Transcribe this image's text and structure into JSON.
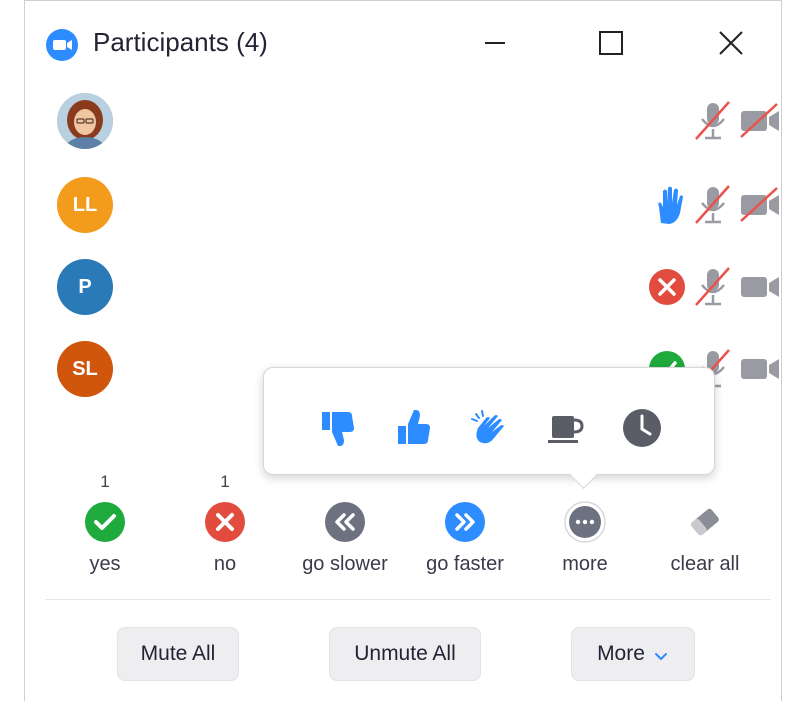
{
  "window": {
    "title": "Participants (4)",
    "icons": {
      "app": "zoom-camera-icon",
      "minimize": "minimize-icon",
      "maximize": "maximize-icon",
      "close": "close-icon"
    }
  },
  "participants": [
    {
      "initials": "",
      "avatar": "photo",
      "color": "#c9a070",
      "statuses": [
        "mic-muted-icon",
        "video-off-icon"
      ]
    },
    {
      "initials": "LL",
      "avatar": "initials",
      "color": "#f39b1c",
      "statuses": [
        "raised-hand-icon",
        "mic-muted-icon",
        "video-off-icon"
      ]
    },
    {
      "initials": "P",
      "avatar": "initials",
      "color": "#2a7ab8",
      "statuses": [
        "no-feedback-icon",
        "mic-muted-icon",
        "video-icon"
      ]
    },
    {
      "initials": "SL",
      "avatar": "initials",
      "color": "#d0550d",
      "statuses": [
        "yes-feedback-icon",
        "mic-muted-icon",
        "video-icon"
      ]
    }
  ],
  "feedback_popup": {
    "items": [
      "thumbs-down-icon",
      "thumbs-up-icon",
      "clap-icon",
      "coffee-icon",
      "clock-icon"
    ]
  },
  "feedback": [
    {
      "label": "yes",
      "count": "1",
      "icon": "check-icon",
      "color": "#1faa3d"
    },
    {
      "label": "no",
      "count": "1",
      "icon": "x-icon",
      "color": "#e24c3f"
    },
    {
      "label": "go slower",
      "count": "",
      "icon": "slower-icon",
      "color": "#6e7280"
    },
    {
      "label": "go faster",
      "count": "",
      "icon": "faster-icon",
      "color": "#2d8cff"
    },
    {
      "label": "more",
      "count": "",
      "icon": "more-icon",
      "color": "#6e7280"
    },
    {
      "label": "clear all",
      "count": "",
      "icon": "eraser-icon",
      "color": "#8a8d96"
    }
  ],
  "buttons": {
    "mute_all": "Mute All",
    "unmute_all": "Unmute All",
    "more": "More"
  },
  "colors": {
    "accent": "#2d8cff",
    "muted_red": "#e8534a",
    "icon_gray": "#8a8d96"
  }
}
